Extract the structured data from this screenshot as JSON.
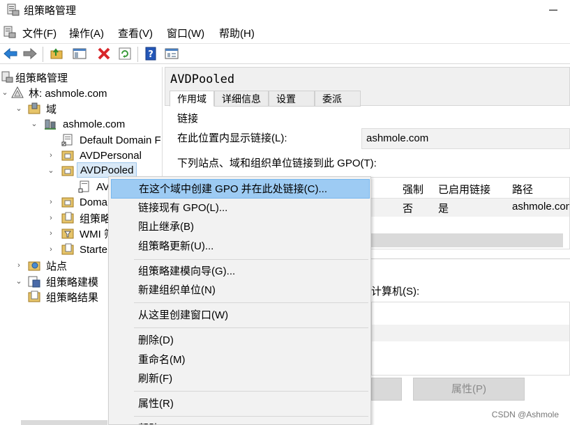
{
  "window": {
    "title": "组策略管理"
  },
  "menubar": {
    "items": [
      "文件(F)",
      "操作(A)",
      "查看(V)",
      "窗口(W)",
      "帮助(H)"
    ]
  },
  "toolbar": {
    "buttons": [
      "back-arrow-icon",
      "forward-arrow-icon",
      "up-folder-icon",
      "show-hide-tree-icon",
      "delete-icon",
      "refresh-icon",
      "help-icon",
      "properties-view-icon"
    ],
    "colors": {
      "back": "#2a7fd4",
      "delete": "#d8262a",
      "refresh": "#3a9a3a",
      "help": "#2457b8"
    }
  },
  "tree": {
    "root": "组策略管理",
    "forest": "林: ashmole.com",
    "domains": "域",
    "domain": "ashmole.com",
    "default_domain": "Default Domain F",
    "avd_personal": "AVDPersonal",
    "avd_pooled": "AVDPooled",
    "avd_child": "AV",
    "domain_controllers": "Doma",
    "gpo_objects": "组策略",
    "wmi": "WMI 筛",
    "starter": "Starte",
    "sites": "站点",
    "modeling": "组策略建模",
    "results": "组策略结果"
  },
  "right_pane": {
    "title": "AVDPooled",
    "tabs": [
      "作用域",
      "详细信息",
      "设置",
      "委派"
    ],
    "section_title": "链接",
    "location_label": "在此位置内显示链接(L):",
    "location_value": "ashmole.com",
    "links_label": "下列站点、域和组织单位链接到此 GPO(T):",
    "grid": {
      "headers": [
        "强制",
        "已启用链接",
        "路径"
      ],
      "rows": [
        {
          "enforced": "否",
          "enabled": "是",
          "path": "ashmole.com"
        }
      ]
    },
    "filter_label": "计算机(S):",
    "properties_button": "属性(P)"
  },
  "context_menu": {
    "items": [
      "在这个域中创建 GPO 并在此处链接(C)...",
      "链接现有 GPO(L)...",
      "阻止继承(B)",
      "组策略更新(U)...",
      "组策略建模向导(G)...",
      "新建组织单位(N)",
      "从这里创建窗口(W)",
      "删除(D)",
      "重命名(M)",
      "刷新(F)",
      "属性(R)",
      "帮助(H)"
    ],
    "hover_color": "#9dcbf3"
  },
  "watermark": "CSDN @Ashmole"
}
